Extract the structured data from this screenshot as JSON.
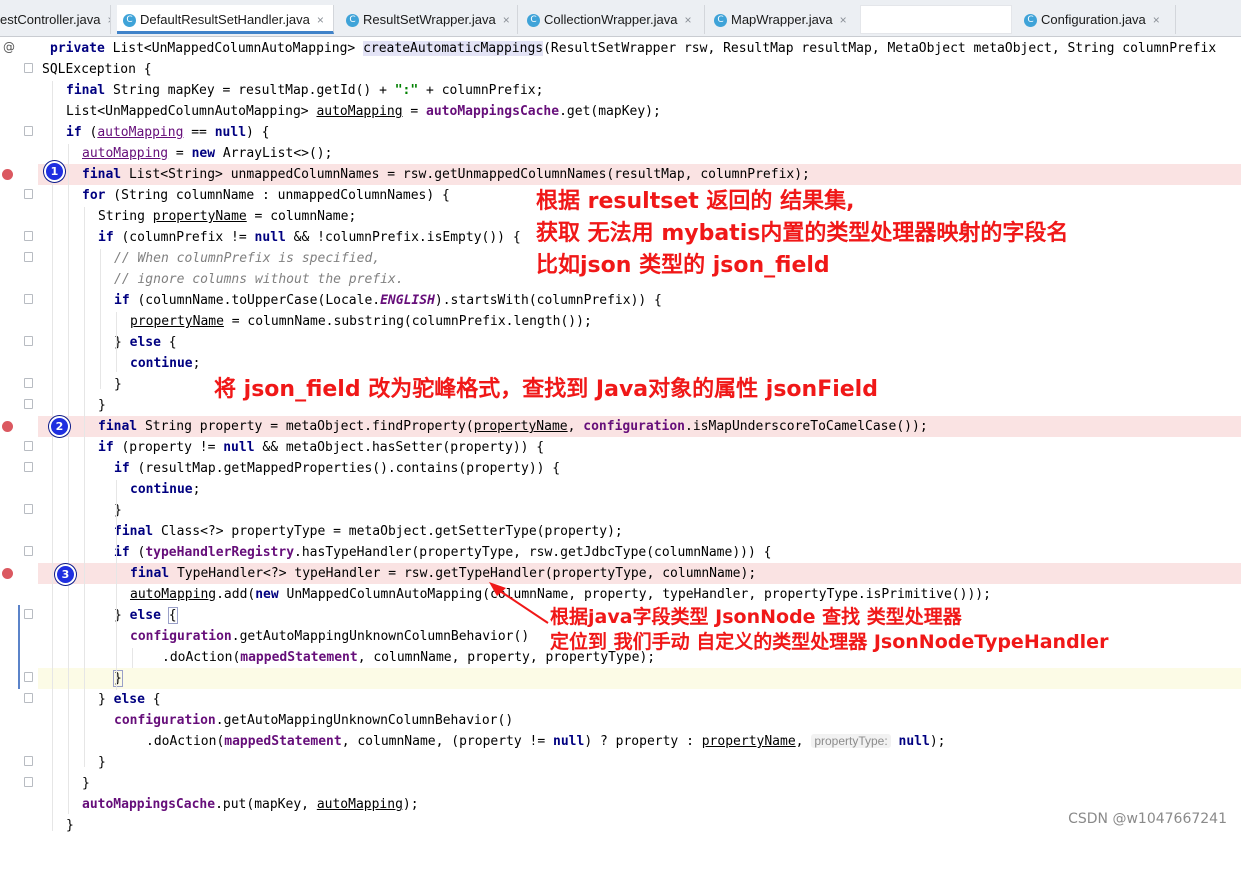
{
  "tabs": [
    {
      "label": "estController.java",
      "active": false
    },
    {
      "label": "DefaultResultSetHandler.java",
      "active": true
    },
    {
      "label": "ResultSetWrapper.java",
      "active": false
    },
    {
      "label": "CollectionWrapper.java",
      "active": false
    },
    {
      "label": "MapWrapper.java",
      "active": false
    },
    {
      "label": "",
      "active": false
    },
    {
      "label": "Configuration.java",
      "active": false
    }
  ],
  "tab_close_glyph": "×",
  "gutter_override_mark": "@",
  "code": {
    "l1": {
      "kw1": "private",
      "t1": " List<UnMappedColumnAutoMapping> ",
      "method": "createAutomaticMappings",
      "t2": "(ResultSetWrapper rsw, ResultMap resultMap, MetaObject metaObject, String columnPrefix"
    },
    "l2": {
      "t1": "SQLException {"
    },
    "l3": {
      "kw1": "final",
      "t1": " String mapKey = resultMap.getId() + ",
      "str": "\":\"",
      "t2": " + columnPrefix;"
    },
    "l4": {
      "t1": "List<UnMappedColumnAutoMapping> ",
      "u1": "autoMapping",
      "t2": " = ",
      "fld": "autoMappingsCache",
      "t3": ".get(mapKey);"
    },
    "l5": {
      "kw1": "if",
      "t1": " (",
      "u1": "autoMapping",
      "t2": " == ",
      "kw2": "null",
      "t3": ") {"
    },
    "l6": {
      "u1": "autoMapping",
      "t1": " = ",
      "kw1": "new",
      "t2": " ArrayList<>();"
    },
    "l7": {
      "kw1": "final",
      "t1": " List<String> unmappedColumnNames = rsw.getUnmappedColumnNames(resultMap, columnPrefix);"
    },
    "l8": {
      "kw1": "for",
      "t1": " (String columnName : unmappedColumnNames) {"
    },
    "l9": {
      "t1": "String ",
      "u1": "propertyName",
      "t2": " = columnName;"
    },
    "l10": {
      "kw1": "if",
      "t1": " (columnPrefix != ",
      "kw2": "null",
      "t2": " && !columnPrefix.isEmpty()) {"
    },
    "l11": {
      "cmt": "// When columnPrefix is specified,"
    },
    "l12": {
      "cmt": "// ignore columns without the prefix."
    },
    "l13": {
      "kw1": "if",
      "t1": " (columnName.toUpperCase(Locale.",
      "itf": "ENGLISH",
      "t2": ").startsWith(columnPrefix)) {"
    },
    "l14": {
      "u1": "propertyName",
      "t1": " = columnName.substring(columnPrefix.length());"
    },
    "l15": {
      "t1": "} ",
      "kw1": "else",
      "t2": " {"
    },
    "l16": {
      "kw1": "continue",
      "t1": ";"
    },
    "l17": {
      "t1": "}"
    },
    "l18": {
      "t1": "}"
    },
    "l19": {
      "kw1": "final",
      "t1": " String property = metaObject.findProperty(",
      "u1": "propertyName",
      "t2": ", ",
      "fld": "configuration",
      "t3": ".isMapUnderscoreToCamelCase());"
    },
    "l20": {
      "kw1": "if",
      "t1": " (property != ",
      "kw2": "null",
      "t2": " && metaObject.hasSetter(property)) {"
    },
    "l21": {
      "kw1": "if",
      "t1": " (resultMap.getMappedProperties().contains(property)) {"
    },
    "l22": {
      "kw1": "continue",
      "t1": ";"
    },
    "l23": {
      "t1": "}"
    },
    "l24": {
      "kw1": "final",
      "t1": " Class<?> propertyType = metaObject.getSetterType(property);"
    },
    "l25": {
      "kw1": "if",
      "t1": " (",
      "fld": "typeHandlerRegistry",
      "t2": ".hasTypeHandler(propertyType, rsw.getJdbcType(columnName))) {"
    },
    "l26": {
      "kw1": "final",
      "t1": " TypeHandler<?> typeHandler = rsw.getTypeHandler(propertyType, columnName);"
    },
    "l27": {
      "u1": "autoMapping",
      "t1": ".add(",
      "kw1": "new",
      "t2": " UnMappedColumnAutoMapping(columnName, property, typeHandler, propertyType.isPrimitive()));"
    },
    "l28": {
      "t1": "} ",
      "kw1": "else",
      "t2": " ",
      "brace": "{"
    },
    "l29": {
      "fld": "configuration",
      "t1": ".getAutoMappingUnknownColumnBehavior()"
    },
    "l30": {
      "t1": ".doAction(",
      "fld": "mappedStatement",
      "t2": ", columnName, property, propertyType);"
    },
    "l31": {
      "brace": "}"
    },
    "l32": {
      "t1": "} ",
      "kw1": "else",
      "t2": " {"
    },
    "l33": {
      "fld": "configuration",
      "t1": ".getAutoMappingUnknownColumnBehavior()"
    },
    "l34": {
      "t1": ".doAction(",
      "fld": "mappedStatement",
      "t2": ", columnName, (property != ",
      "kw1": "null",
      "t3": ") ? property : ",
      "u1": "propertyName",
      "t4": ", ",
      "hint": "propertyType:",
      "t5": " ",
      "kw2": "null",
      "t6": ");"
    },
    "l35": {
      "t1": "}"
    },
    "l36": {
      "t1": "}"
    },
    "l37": {
      "fld": "autoMappingsCache",
      "t1": ".put(mapKey, ",
      "u1": "autoMapping",
      "t2": ");"
    },
    "l38": {
      "t1": "}"
    }
  },
  "badges": [
    "1",
    "2",
    "3"
  ],
  "annotations": {
    "a1_line1": "根据 resultset 返回的 结果集,",
    "a1_line2": "获取 无法用 mybatis内置的类型处理器映射的字段名",
    "a1_line3": "比如json 类型的 json_field",
    "a2": "将 json_field 改为驼峰格式，查找到 Java对象的属性 jsonField",
    "a3_line1": "根据java字段类型 JsonNode 查找 类型处理器",
    "a3_line2": "定位到 我们手动 自定义的类型处理器 JsonNodeTypeHandler"
  },
  "watermark": "CSDN @w1047667241",
  "colors": {
    "annotation": "#f01818",
    "badge": "#1f2fe0",
    "breakpoint": "#db5860",
    "breakpoint_line": "#fae3e3",
    "keyword": "#000080",
    "field": "#660e7a"
  }
}
